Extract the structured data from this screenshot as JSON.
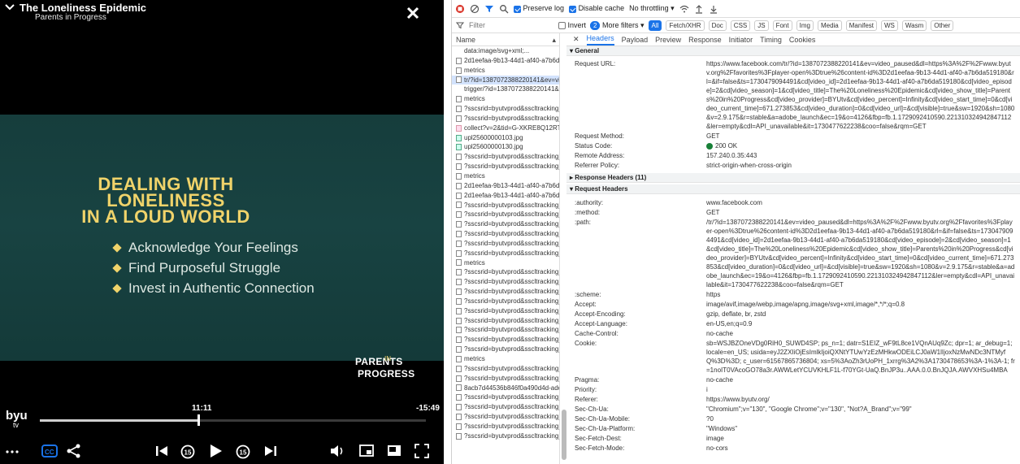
{
  "player": {
    "title": "The Loneliness Epidemic",
    "subtitle": "Parents in Progress",
    "slide_title_l1": "DEALING WITH",
    "slide_title_l2": "LONELINESS",
    "slide_title_l3": "IN A LOUD WORLD",
    "bullets": [
      "Acknowledge Your Feelings",
      "Find Purposeful Struggle",
      "Invest in Authentic Connection"
    ],
    "brand_a": "PARENTS",
    "brand_in": "IN",
    "brand_b": "PROGRESS",
    "current_time": "11:11",
    "remaining_time": "-15:49",
    "progress_fraction": 0.415
  },
  "devtools": {
    "toolbar": {
      "preserve_log": "Preserve log",
      "disable_cache": "Disable cache",
      "throttling": "No throttling"
    },
    "filterbar": {
      "filter_placeholder": "Filter",
      "invert": "Invert",
      "more_filters": "More filters",
      "more_count": "2",
      "types": [
        "All",
        "Fetch/XHR",
        "Doc",
        "CSS",
        "JS",
        "Font",
        "Img",
        "Media",
        "Manifest",
        "WS",
        "Wasm",
        "Other"
      ]
    },
    "name_header": "Name",
    "requests": [
      {
        "name": "data:image/svg+xml;...",
        "icon": "none"
      },
      {
        "name": "2d1eefaa-9b13-44d1-af40-a7b6da5...",
        "icon": "doc"
      },
      {
        "name": "metrics",
        "icon": "doc"
      },
      {
        "name": "tr/?id=1387072388220141&ev=vide...",
        "icon": "doc"
      },
      {
        "name": "trigger/?id=1387072388220141&ev...",
        "icon": "none"
      },
      {
        "name": "metrics",
        "icon": "doc"
      },
      {
        "name": "?sscsrid=byutvprod&sscltracking_s...",
        "icon": "doc"
      },
      {
        "name": "?sscsrid=byutvprod&sscltracking_s...",
        "icon": "doc"
      },
      {
        "name": "collect?v=2&tid=G-XKRE8Q12RT&gt...",
        "icon": "script"
      },
      {
        "name": "upl25600000103.jpg",
        "icon": "img"
      },
      {
        "name": "upl25600000130.jpg",
        "icon": "img"
      },
      {
        "name": "?sscsrid=byutvprod&sscltracking_s...",
        "icon": "doc"
      },
      {
        "name": "?sscsrid=byutvprod&sscltracking_s...",
        "icon": "doc"
      },
      {
        "name": "metrics",
        "icon": "doc"
      },
      {
        "name": "2d1eefaa-9b13-44d1-af40-a7b6da5...",
        "icon": "doc"
      },
      {
        "name": "2d1eefaa-9b13-44d1-af40-a7b6da5...",
        "icon": "doc"
      },
      {
        "name": "?sscsrid=byutvprod&sscltracking_s...",
        "icon": "doc"
      },
      {
        "name": "?sscsrid=byutvprod&sscltracking_s...",
        "icon": "doc"
      },
      {
        "name": "?sscsrid=byutvprod&sscltracking_s...",
        "icon": "doc"
      },
      {
        "name": "?sscsrid=byutvprod&sscltracking_s...",
        "icon": "doc"
      },
      {
        "name": "?sscsrid=byutvprod&sscltracking_s...",
        "icon": "doc"
      },
      {
        "name": "?sscsrid=byutvprod&sscltracking_s...",
        "icon": "doc"
      },
      {
        "name": "metrics",
        "icon": "doc"
      },
      {
        "name": "?sscsrid=byutvprod&sscltracking_s...",
        "icon": "doc"
      },
      {
        "name": "?sscsrid=byutvprod&sscltracking_s...",
        "icon": "doc"
      },
      {
        "name": "?sscsrid=byutvprod&sscltracking_s...",
        "icon": "doc"
      },
      {
        "name": "?sscsrid=byutvprod&sscltracking_s...",
        "icon": "doc"
      },
      {
        "name": "?sscsrid=byutvprod&sscltracking_s...",
        "icon": "doc"
      },
      {
        "name": "?sscsrid=byutvprod&sscltracking_s...",
        "icon": "doc"
      },
      {
        "name": "?sscsrid=byutvprod&sscltracking_s...",
        "icon": "doc"
      },
      {
        "name": "?sscsrid=byutvprod&sscltracking_s...",
        "icon": "doc"
      },
      {
        "name": "?sscsrid=byutvprod&sscltracking_s...",
        "icon": "doc"
      },
      {
        "name": "metrics",
        "icon": "doc"
      },
      {
        "name": "?sscsrid=byutvprod&sscltracking_s...",
        "icon": "doc"
      },
      {
        "name": "?sscsrid=byutvprod&sscltracking_s...",
        "icon": "doc"
      },
      {
        "name": "8acb7d44536b846f0a490d4d-adobe...",
        "icon": "doc"
      },
      {
        "name": "?sscsrid=byutvprod&sscltracking_s...",
        "icon": "doc"
      },
      {
        "name": "?sscsrid=byutvprod&sscltracking_s...",
        "icon": "doc"
      },
      {
        "name": "?sscsrid=byutvprod&sscltracking_s...",
        "icon": "doc"
      },
      {
        "name": "?sscsrid=byutvprod&sscltracking_s...",
        "icon": "doc"
      },
      {
        "name": "?sscsrid=byutvprod&sscltracking_s...",
        "icon": "doc"
      }
    ],
    "tabs": [
      "Headers",
      "Payload",
      "Preview",
      "Response",
      "Initiator",
      "Timing",
      "Cookies"
    ],
    "general_label": "General",
    "general": [
      {
        "k": "Request URL:",
        "v": "https://www.facebook.com/tr/?id=1387072388220141&ev=video_paused&dl=https%3A%2F%2Fwww.byutv.org%2Ffavorites%3Fplayer-open%3Dtrue%26content-id%3D2d1eefaa-9b13-44d1-af40-a7b6da519180&rl=&if=false&ts=1730479094491&cd[video_id]=2d1eefaa-9b13-44d1-af40-a7b6da519180&cd[video_episode]=2&cd[video_season]=1&cd[video_title]=The%20Loneliness%20Epidemic&cd[video_show_title]=Parents%20in%20Progress&cd[video_provider]=BYUtv&cd[video_percent]=Infinity&cd[video_start_time]=0&cd[video_current_time]=671.273853&cd[video_duration]=0&cd[video_url]=&cd[visible]=true&sw=1920&sh=1080&v=2.9.175&r=stable&a=adobe_launch&ec=19&o=4126&fbp=fb.1.1729092410590.221310324942847112&ler=empty&cdl=API_unavailable&it=1730477622238&coo=false&rqm=GET"
      },
      {
        "k": "Request Method:",
        "v": "GET"
      },
      {
        "k": "Status Code:",
        "v": "200 OK"
      },
      {
        "k": "Remote Address:",
        "v": "157.240.0.35:443"
      },
      {
        "k": "Referrer Policy:",
        "v": "strict-origin-when-cross-origin"
      }
    ],
    "response_headers_label": "Response Headers (11)",
    "request_headers_label": "Request Headers",
    "request_headers": [
      {
        "k": ":authority:",
        "v": "www.facebook.com"
      },
      {
        "k": ":method:",
        "v": "GET"
      },
      {
        "k": ":path:",
        "v": "/tr/?id=1387072388220141&ev=video_paused&dl=https%3A%2F%2Fwww.byutv.org%2Ffavorites%3Fplayer-open%3Dtrue%26content-id%3D2d1eefaa-9b13-44d1-af40-a7b6da519180&rl=&if=false&ts=1730479094491&cd[video_id]=2d1eefaa-9b13-44d1-af40-a7b6da519180&cd[video_episode]=2&cd[video_season]=1&cd[video_title]=The%20Loneliness%20Epidemic&cd[video_show_title]=Parents%20in%20Progress&cd[video_provider]=BYUtv&cd[video_percent]=Infinity&cd[video_start_time]=0&cd[video_current_time]=671.273853&cd[video_duration]=0&cd[video_url]=&cd[visible]=true&sw=1920&sh=1080&v=2.9.175&r=stable&a=adobe_launch&ec=19&o=4126&fbp=fb.1.1729092410590.221310324942847112&ler=empty&cdl=API_unavailable&it=1730477622238&coo=false&rqm=GET"
      },
      {
        "k": ":scheme:",
        "v": "https"
      },
      {
        "k": "Accept:",
        "v": "image/avif,image/webp,image/apng,image/svg+xml,image/*,*/*;q=0.8"
      },
      {
        "k": "Accept-Encoding:",
        "v": "gzip, deflate, br, zstd"
      },
      {
        "k": "Accept-Language:",
        "v": "en-US,en;q=0.9"
      },
      {
        "k": "Cache-Control:",
        "v": "no-cache"
      },
      {
        "k": "Cookie:",
        "v": "sb=WSJBZOneVDg0RiH0_SUWD4SP; ps_n=1; datr=S1EIZ_wF9tL8ce1VQnAUq9Zc; dpr=1; ar_debug=1; locale=en_US; usida=eyJ2ZXIiOjEsImlkIjoiQXNtYTUwYzEzMHkwODEiLCJ0aW1lIjoxNzMwNDc3NTMyfQ%3D%3D; c_user=61567865736804; xs=5%3AoZh3rUoPH_1xrrg%3A2%3A1730478653%3A-1%3A-1; fr=1noIT0VAcoGO78a3r.AWWLetYCUVKHLF1L-f70YGt-UaQ.BnJP3u..AAA.0.0.BnJQJA.AWVXHSu4MBA"
      },
      {
        "k": "Pragma:",
        "v": "no-cache"
      },
      {
        "k": "Priority:",
        "v": "i"
      },
      {
        "k": "Referer:",
        "v": "https://www.byutv.org/"
      },
      {
        "k": "Sec-Ch-Ua:",
        "v": "\"Chromium\";v=\"130\", \"Google Chrome\";v=\"130\", \"Not?A_Brand\";v=\"99\""
      },
      {
        "k": "Sec-Ch-Ua-Mobile:",
        "v": "?0"
      },
      {
        "k": "Sec-Ch-Ua-Platform:",
        "v": "\"Windows\""
      },
      {
        "k": "Sec-Fetch-Dest:",
        "v": "image"
      },
      {
        "k": "Sec-Fetch-Mode:",
        "v": "no-cors"
      }
    ]
  }
}
